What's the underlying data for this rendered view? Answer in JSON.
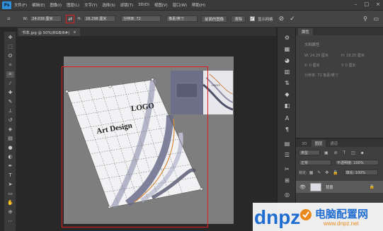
{
  "menubar": {
    "logo": "Ps",
    "items": [
      "文件(F)",
      "编辑(E)",
      "图像(I)",
      "图层(L)",
      "文字(Y)",
      "选择(S)",
      "滤镜(T)",
      "3D(D)",
      "视图(V)",
      "窗口(W)",
      "帮助(H)"
    ]
  },
  "options": {
    "w_label": "W:",
    "w_value": "24.039 厘米",
    "swap_icon": "⇄",
    "h_label": "H:",
    "h_value": "16.298 厘米",
    "res_value": "分辨率: 72",
    "unit_value": "像素/英寸",
    "front_image": "前面的图像",
    "clear": "清除",
    "perspective_label": "显示网格",
    "cancel_icon": "⊘",
    "commit_icon": "✓"
  },
  "document": {
    "tab_title": "书本.jpg @ 50%(RGB/8#)",
    "close_icon": "×"
  },
  "cover": {
    "logo": "LOGO",
    "title": "Art Design"
  },
  "properties_panel": {
    "tab": "属性",
    "section": "文档属性",
    "w": "W: 24.29 厘米",
    "h": "H: 18.25 厘米",
    "x": "X: 0 厘米",
    "y": "Y: 0 厘米",
    "resolution": "分辨率: 72 像素/英寸"
  },
  "layers_panel": {
    "tabs": [
      "3D",
      "图层",
      "通道"
    ],
    "kind_filter": "类型",
    "blend_mode": "正常",
    "opacity": "不透明度: 100%",
    "lock_label": "锁定:",
    "fill": "填充: 100%",
    "layer_name": "背景"
  },
  "watermark": {
    "brand": "dnpz",
    "site": "电脑配置网",
    "url": "www.dnpz.net"
  },
  "colors": {
    "crop_frame": "#e02020",
    "app_bg": "#282828",
    "panel_bg": "#3f3f3f",
    "brand_blue": "#1f6fd6",
    "brand_orange": "#f08c1a"
  }
}
